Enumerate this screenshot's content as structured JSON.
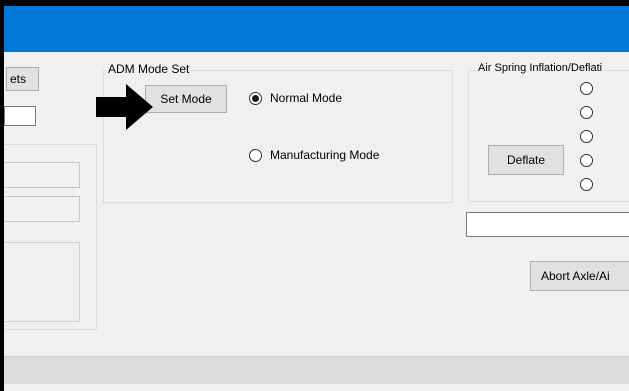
{
  "left_panel": {
    "partial_button_label": "ets"
  },
  "adm_mode": {
    "group_title": "ADM Mode Set",
    "set_mode_label": "Set Mode",
    "normal_mode_label": "Normal Mode",
    "normal_mode_selected": true,
    "manufacturing_mode_label": "Manufacturing Mode",
    "manufacturing_mode_selected": false
  },
  "air_spring": {
    "group_title": "Air Spring Inflation/Deflati",
    "deflate_label": "Deflate",
    "abort_label": "Abort Axle/Ai"
  },
  "icons": {
    "pointer": "arrow-right-icon"
  },
  "colors": {
    "titlebar": "#0078d7",
    "window_bg": "#f0f0f0"
  }
}
